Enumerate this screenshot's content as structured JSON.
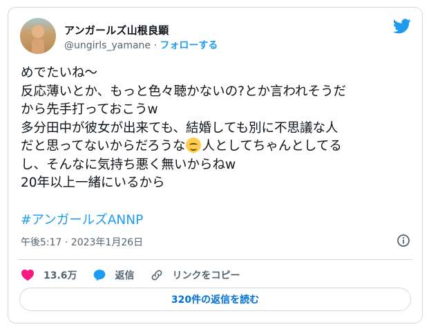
{
  "tweet": {
    "author_name": "アンガールズ山根良顕",
    "handle": "@ungirls_yamane",
    "separator": " · ",
    "follow_label": "フォローする",
    "text_part1": "めでたいね〜\n反応薄いとか、もっと色々聴かないの?とか言われそうだ\nから先手打っておこうw\n多分田中が彼女が出来ても、結婚しても別に不思議な人\nだと思ってないからだろうな",
    "text_part2": "人としてちゃんとしてる\nし、そんなに気持ち悪く無いからねw\n20年以上一緒にいるから",
    "hashtag": "#アンガールズANNP",
    "timestamp": "午後5:17 · 2023年1月26日",
    "like_count": "13.6万",
    "reply_label": "返信",
    "copy_link_label": "リンクをコピー",
    "read_replies_label": "320件の返信を読む"
  },
  "colors": {
    "accent": "#1d9bf0",
    "like": "#f91880",
    "muted": "#536471",
    "border": "#cfd9de",
    "link_button": "#006fd6"
  },
  "icons": [
    "twitter-bird-icon",
    "smiling-face-emoji",
    "info-icon",
    "heart-icon",
    "reply-bubble-icon",
    "link-icon"
  ]
}
